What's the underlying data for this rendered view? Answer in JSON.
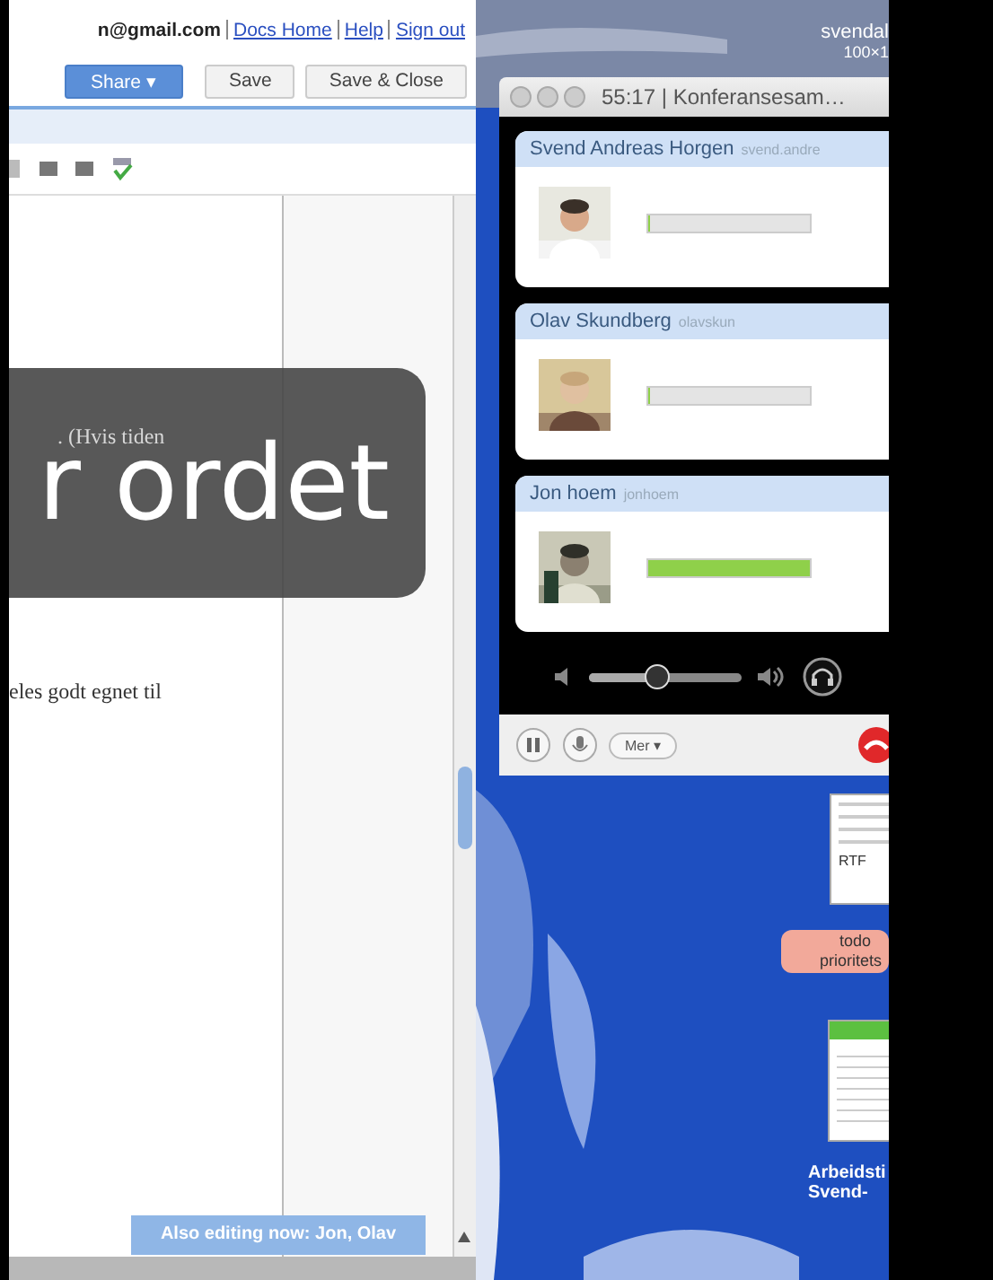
{
  "docs_window": {
    "account": "n@gmail.com",
    "links": [
      "Docs Home",
      "Help",
      "Sign out"
    ],
    "buttons": [
      {
        "label": "Share ▾",
        "kind": "primary"
      },
      {
        "label": "Save",
        "kind": "plain"
      },
      {
        "label": "Save & Close",
        "kind": "plain"
      }
    ],
    "document_lines": [
      ". (Hvis tiden",
      "eles godt egnet til"
    ],
    "collaborators_notice": "Also editing now: Jon, Olav"
  },
  "video_caption": "r ordet",
  "desktop": {
    "user_label": [
      "svendal",
      "100×1"
    ]
  },
  "conference_window": {
    "title": "55:17 | Konferansesam…",
    "participants": [
      {
        "name": "Svend Andreas Horgen",
        "username": "svend.andre",
        "level": 0
      },
      {
        "name": "Olav Skundberg",
        "username": "olavskun",
        "level": 0
      },
      {
        "name": "Jon hoem",
        "username": "jonhoem",
        "level": 1
      }
    ],
    "volume": {
      "level": 0.45
    },
    "more_menu": "Mer ▾"
  },
  "desktop_icons": [
    {
      "kind": "document",
      "lines": [
        "RTF"
      ]
    },
    {
      "kind": "note",
      "lines": [
        "todo",
        "prioritets"
      ]
    },
    {
      "kind": "spreadsheet",
      "lines": [
        "Arbeidsti",
        "Svend-"
      ]
    }
  ]
}
